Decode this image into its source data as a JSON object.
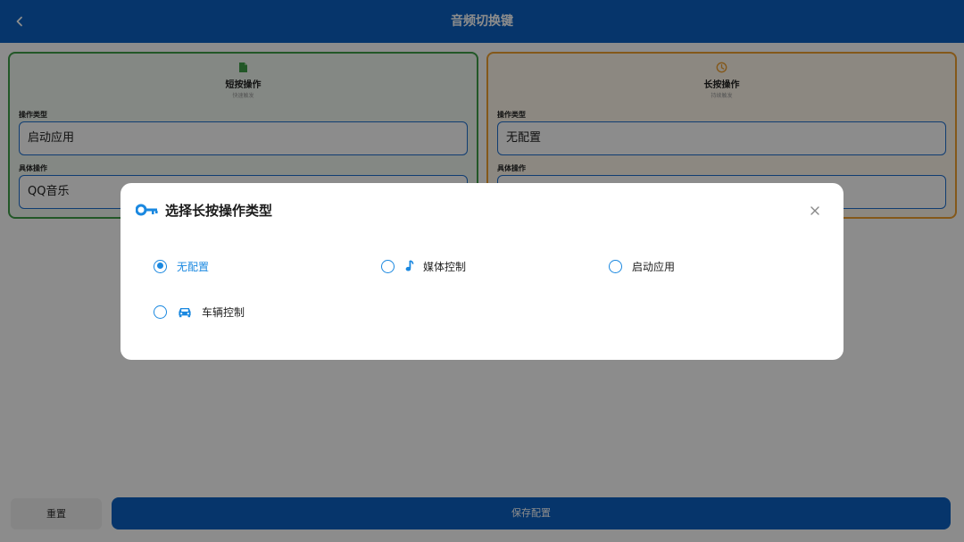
{
  "header": {
    "title": "音频切换键"
  },
  "short_card": {
    "title": "短按操作",
    "subtitle": "快速触发",
    "type_label": "操作类型",
    "type_value": "启动应用",
    "detail_label": "具体操作",
    "detail_value": "QQ音乐"
  },
  "long_card": {
    "title": "长按操作",
    "subtitle": "持续触发",
    "type_label": "操作类型",
    "type_value": "无配置",
    "detail_label": "具体操作",
    "detail_value": ""
  },
  "footer": {
    "reset_label": "重置",
    "save_label": "保存配置"
  },
  "dialog": {
    "title": "选择长按操作类型",
    "options": [
      {
        "label": "无配置",
        "icon": "",
        "selected": true
      },
      {
        "label": "媒体控制",
        "icon": "music-note-icon",
        "selected": false
      },
      {
        "label": "启动应用",
        "icon": "",
        "selected": false
      },
      {
        "label": "车辆控制",
        "icon": "car-icon",
        "selected": false
      }
    ]
  },
  "colors": {
    "primary": "#0b62c4",
    "accent": "#1a88e0",
    "short_border": "#3f9e48",
    "long_border": "#f0a030"
  }
}
